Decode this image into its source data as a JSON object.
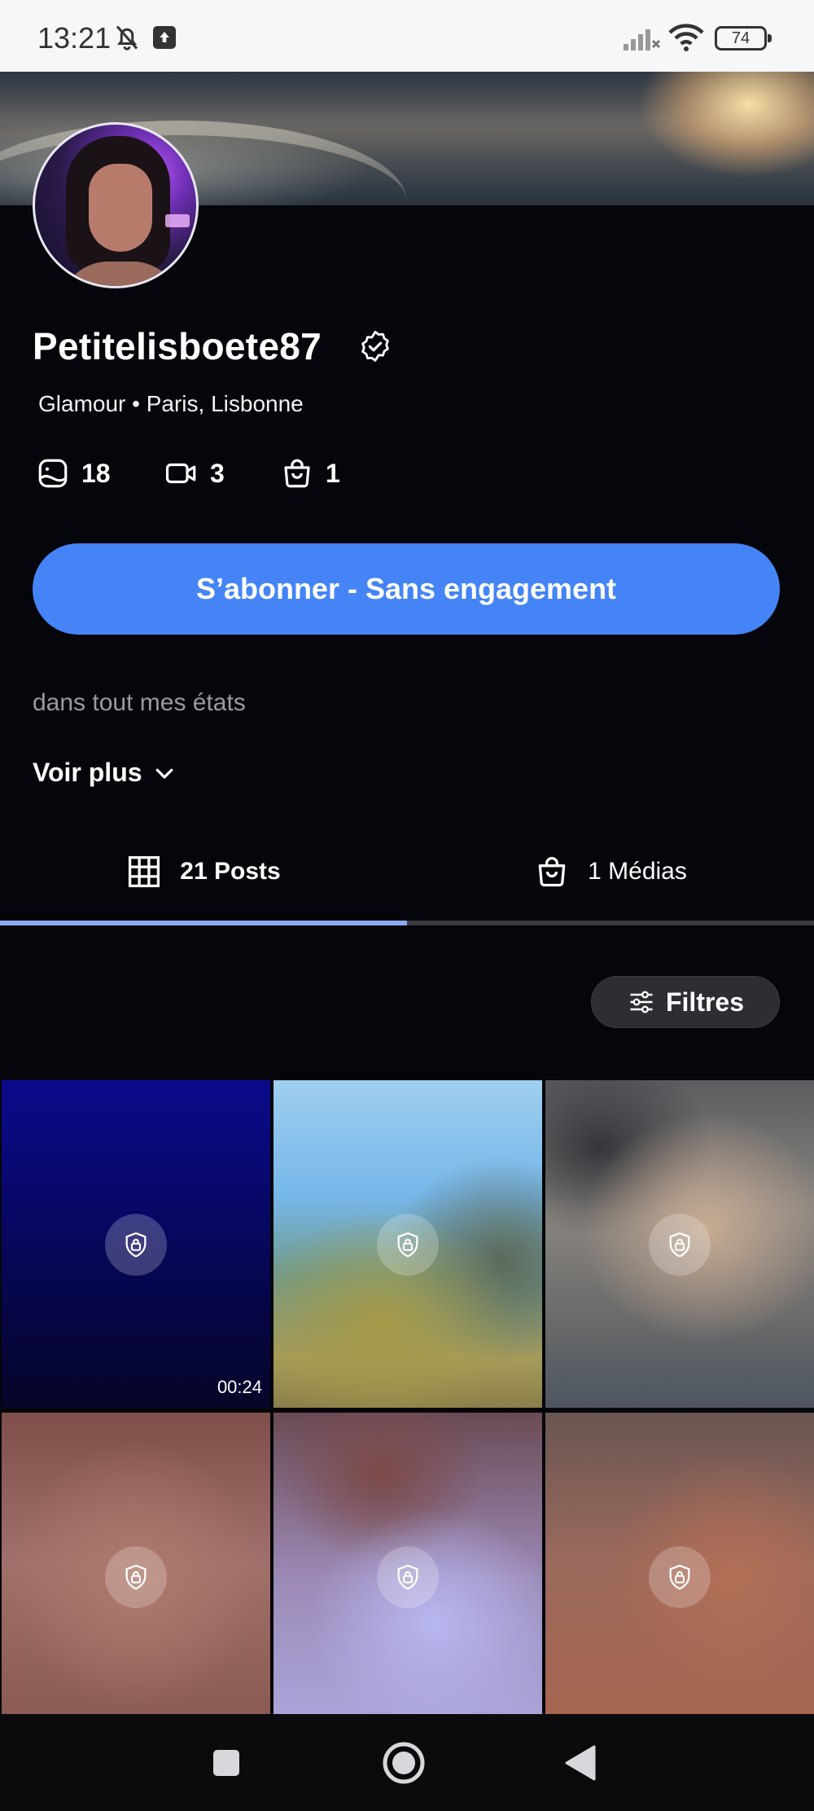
{
  "status_bar": {
    "time": "13:21",
    "battery": "74"
  },
  "profile": {
    "username": "Petitelisboete87",
    "tagline": "Glamour • Paris, Lisbonne",
    "stats": {
      "photos": "18",
      "videos": "3",
      "shop": "1"
    },
    "subscribe_label": "S’abonner - Sans engagement",
    "bio": "dans tout mes états",
    "see_more_label": "Voir plus"
  },
  "tabs": {
    "posts": "21 Posts",
    "media": "1 Médias"
  },
  "filter_label": "Filtres",
  "grid": {
    "first_duration": "00:24"
  },
  "colors": {
    "accent": "#4484f7",
    "background": "#05060b",
    "tab_indicator": "#8eaaf2"
  }
}
